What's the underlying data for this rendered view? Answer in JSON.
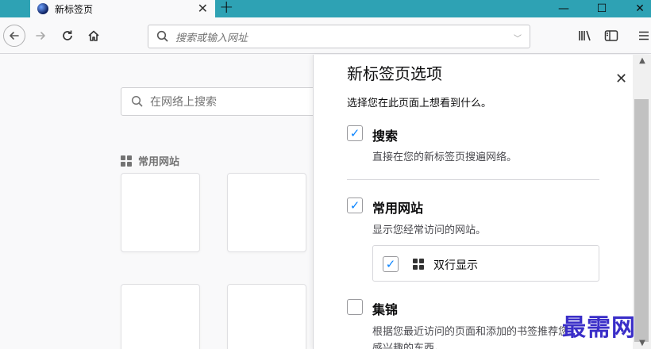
{
  "tab": {
    "title": "新标签页"
  },
  "window": {
    "minimize": "—",
    "maximize": "☐",
    "close": "✕"
  },
  "urlbar": {
    "placeholder": "搜索或输入网址"
  },
  "page": {
    "search_placeholder": "在网络上搜索",
    "topsites_label": "常用网站"
  },
  "panel": {
    "title": "新标签页选项",
    "description": "选择您在此页面上想看到什么。",
    "options": [
      {
        "label": "搜索",
        "description": "直接在您的新标签页搜遍网络。",
        "checked": true
      },
      {
        "label": "常用网站",
        "description": "显示您经常访问的网站。",
        "checked": true
      },
      {
        "label": "集锦",
        "description": "根据您最近访问的页面和添加的书签推荐您",
        "description2": "感兴趣的东西。",
        "checked": false
      }
    ],
    "sub_option": {
      "label": "双行显示",
      "checked": true
    }
  },
  "watermark": "最需网",
  "colors": {
    "tabbar": "#2ea2b4",
    "accent": "#0a84ff",
    "watermark": "#3a2ec8"
  }
}
